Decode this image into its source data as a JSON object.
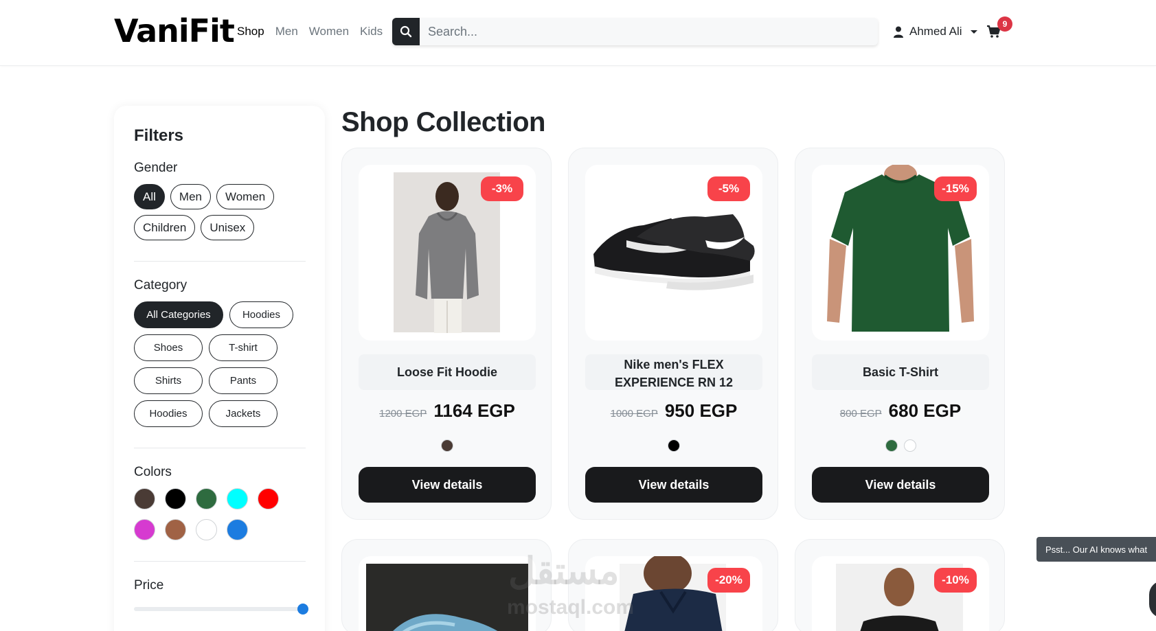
{
  "header": {
    "logo": "VaniFit",
    "nav": [
      "Shop",
      "Men",
      "Women",
      "Kids"
    ],
    "search_placeholder": "Search...",
    "user_name": "Ahmed Ali",
    "cart_count": "9"
  },
  "sidebar": {
    "title": "Filters",
    "gender_label": "Gender",
    "genders": [
      "All",
      "Men",
      "Women",
      "Children",
      "Unisex"
    ],
    "category_label": "Category",
    "categories": [
      "All Categories",
      "Hoodies",
      "Shoes",
      "T-shirt",
      "Shirts",
      "Pants",
      "Hoodies",
      "Jackets"
    ],
    "colors_label": "Colors",
    "colors": [
      "#4a3b35",
      "#000000",
      "#2e6b3f",
      "#00ffff",
      "#ff0000",
      "#d63ad0",
      "#a06245",
      "#ffffff",
      "#1c7ce0"
    ],
    "price_label": "Price",
    "price_fraction": 1.0
  },
  "main": {
    "title": "Shop Collection",
    "view_label": "View details",
    "products": [
      {
        "name": "Loose Fit Hoodie",
        "old_price": "1200 EGP",
        "price": "1164 EGP",
        "discount": "-3%",
        "colors": [
          "#4a3b35"
        ],
        "image": "hoodie-image"
      },
      {
        "name": "Nike men's FLEX EXPERIENCE RN 12",
        "old_price": "1000 EGP",
        "price": "950 EGP",
        "discount": "-5%",
        "colors": [
          "#000000"
        ],
        "image": "sneaker-image"
      },
      {
        "name": "Basic T-Shirt",
        "old_price": "800 EGP",
        "price": "680 EGP",
        "discount": "-15%",
        "colors": [
          "#2e6b3f",
          "#ffffff"
        ],
        "image": "tshirt-image"
      }
    ],
    "row2_discounts": [
      "",
      "-20%",
      "-10%"
    ]
  },
  "toast": "Psst... Our AI knows what",
  "watermark": "mostaql.com",
  "watermark_ar": "مستقل"
}
